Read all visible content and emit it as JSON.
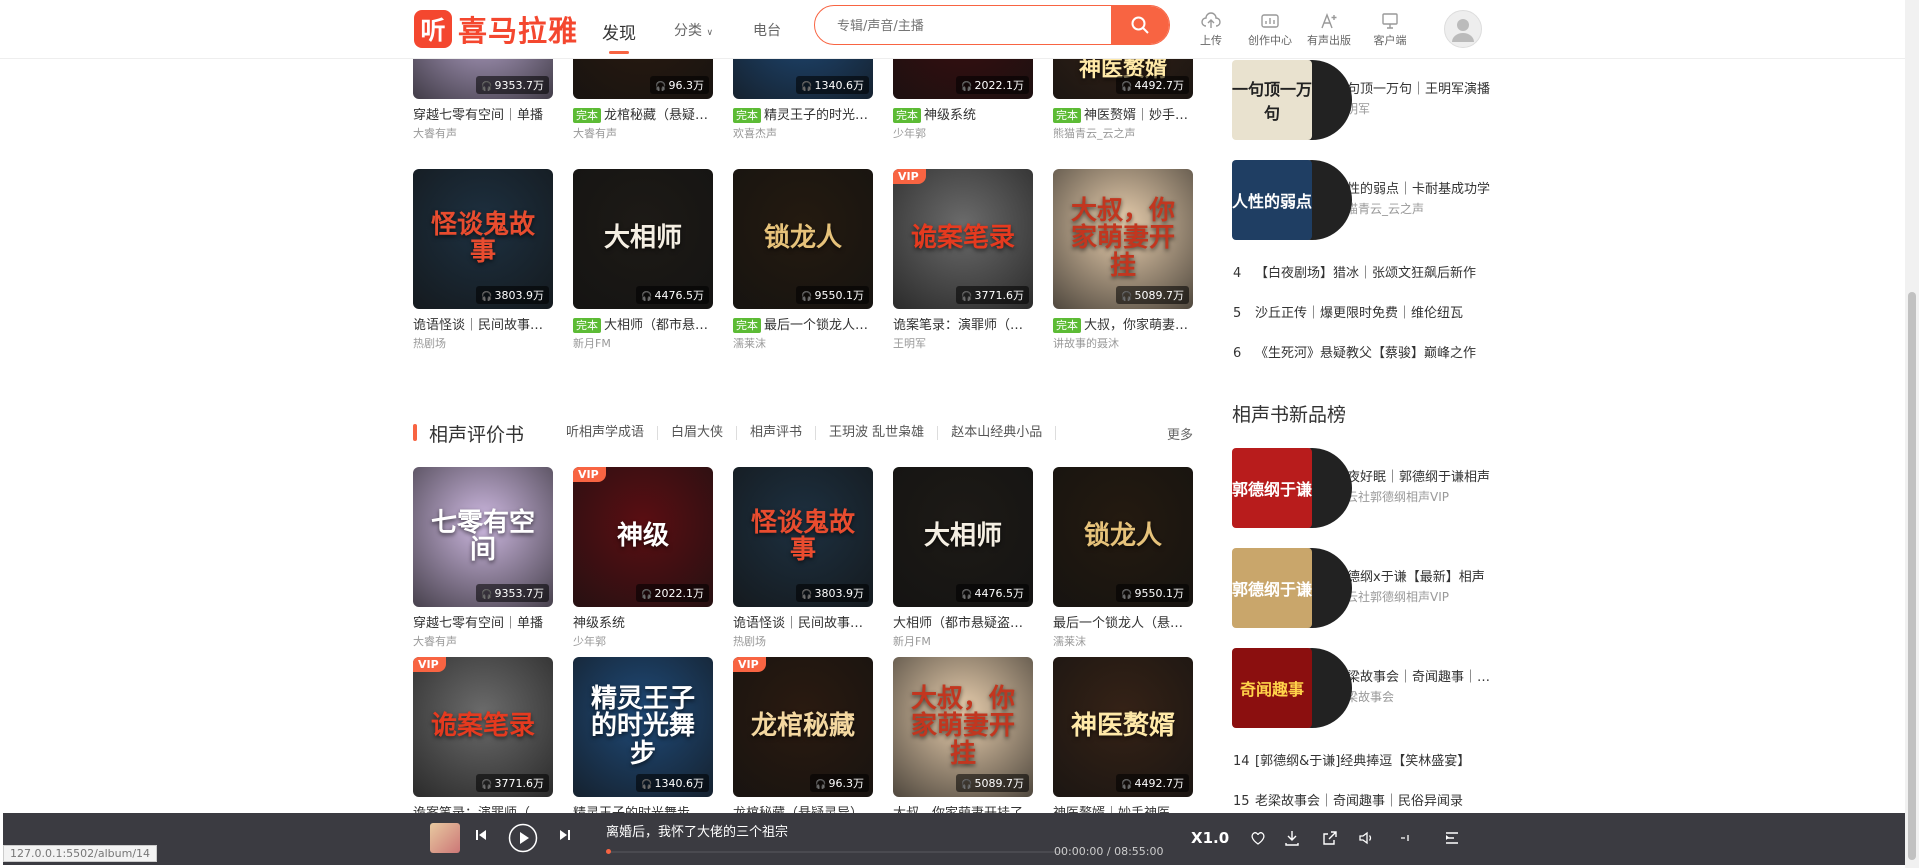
{
  "header": {
    "logo_glyph": "听",
    "logo_text": "喜马拉雅",
    "nav": {
      "discover": "发现",
      "category": "分类",
      "radio": "电台"
    },
    "search_placeholder": "专辑/声音/主播",
    "tools": {
      "upload": "上传",
      "creator": "创作中心",
      "publish": "有声出版",
      "client": "客户端"
    }
  },
  "grid_top": [
    {
      "cover": "",
      "plays": "9353.7万",
      "tag": "",
      "title": "穿越七零有空间｜单播",
      "author": "大睿有声",
      "bg": "#b9a8cf",
      "fg": "#fff"
    },
    {
      "cover": "",
      "plays": "96.3万",
      "tag": "完本",
      "title": "龙棺秘藏（悬疑灵异）",
      "author": "大睿有声",
      "bg": "#2a1a10",
      "fg": "#f3d7a0"
    },
    {
      "cover": "",
      "plays": "1340.6万",
      "tag": "完本",
      "title": "精灵王子的时光舞步",
      "author": "欢喜杰声",
      "bg": "#1f4a78",
      "fg": "#fff"
    },
    {
      "cover": "",
      "plays": "2022.1万",
      "tag": "完本",
      "title": "神级系统",
      "author": "少年郭",
      "bg": "#3a0e10",
      "fg": "#fff"
    },
    {
      "cover": "神医赘婿",
      "plays": "4492.7万",
      "tag": "完本",
      "title": "神医赘婿｜妙手神医",
      "author": "熊猫青云_云之声",
      "bg": "#352216",
      "fg": "#ffe9a8"
    }
  ],
  "grid_row2": [
    {
      "cover": "怪谈鬼故事",
      "plays": "3803.9万",
      "tag": "",
      "vip": "",
      "title": "诡语怪谈｜民间故事合集",
      "author": "热剧场",
      "bg": "#1d3040",
      "fg": "#e84c2f"
    },
    {
      "cover": "大相师",
      "plays": "4476.5万",
      "tag": "完本",
      "vip": "",
      "title": "大相师（都市悬疑盗墓）",
      "author": "新月FM",
      "bg": "#1d1a16",
      "fg": "#f5efe3"
    },
    {
      "cover": "锁龙人",
      "plays": "9550.1万",
      "tag": "完本",
      "vip": "",
      "title": "最后一个锁龙人（悬疑）",
      "author": "濡莱沫",
      "bg": "#241a10",
      "fg": "#e6c27a"
    },
    {
      "cover": "诡案笔录",
      "plays": "3771.6万",
      "tag": "",
      "vip": "VIP",
      "title": "诡案笔录：演罪师（刑侦）",
      "author": "王明军",
      "bg": "#6b6b6b",
      "fg": "#e53a1f"
    },
    {
      "cover": "大叔，你家萌妻开挂",
      "plays": "5089.7万",
      "tag": "完本",
      "vip": "",
      "title": "大叔，你家萌妻开挂了",
      "author": "讲故事的聂沐",
      "bg": "#e9cfae",
      "fg": "#c2361f"
    }
  ],
  "category": {
    "title": "相声评价书",
    "tabs": [
      "听相声学成语",
      "白眉大侠",
      "相声评书",
      "王玥波 乱世枭雄",
      "赵本山经典小品"
    ],
    "more": "更多"
  },
  "grid_row3": [
    {
      "cover": "七零有空间",
      "plays": "9353.7万",
      "vip": "",
      "title": "穿越七零有空间｜单播",
      "author": "大睿有声",
      "bg": "#cdb8e0",
      "fg": "#fff"
    },
    {
      "cover": "神级",
      "plays": "2022.1万",
      "vip": "VIP",
      "title": "神级系统",
      "author": "少年郭",
      "bg": "#5a0e12",
      "fg": "#fff"
    },
    {
      "cover": "怪谈鬼故事",
      "plays": "3803.9万",
      "vip": "",
      "title": "诡语怪谈｜民间故事合集",
      "author": "热剧场",
      "bg": "#1d3040",
      "fg": "#e84c2f"
    },
    {
      "cover": "大相师",
      "plays": "4476.5万",
      "vip": "",
      "title": "大相师（都市悬疑盗墓）",
      "author": "新月FM",
      "bg": "#1d1a16",
      "fg": "#f5efe3"
    },
    {
      "cover": "锁龙人",
      "plays": "9550.1万",
      "vip": "",
      "title": "最后一个锁龙人（悬疑）",
      "author": "濡莱沫",
      "bg": "#241a10",
      "fg": "#e6c27a"
    }
  ],
  "grid_row4": [
    {
      "cover": "诡案笔录",
      "plays": "3771.6万",
      "vip": "VIP",
      "title": "诡案笔录：演罪师（刑侦）",
      "bg": "#6b6b6b",
      "fg": "#e53a1f"
    },
    {
      "cover": "精灵王子的时光舞步",
      "plays": "1340.6万",
      "vip": "",
      "title": "精灵王子的时光舞步",
      "bg": "#1f4a78",
      "fg": "#fff"
    },
    {
      "cover": "龙棺秘藏",
      "plays": "96.3万",
      "vip": "VIP",
      "title": "龙棺秘藏（悬疑灵异）",
      "bg": "#2a1a10",
      "fg": "#f3d7a0"
    },
    {
      "cover": "大叔，你家萌妻开挂",
      "plays": "5089.7万",
      "vip": "",
      "title": "大叔，你家萌妻开挂了",
      "bg": "#e9cfae",
      "fg": "#c2361f"
    },
    {
      "cover": "神医赘婿",
      "plays": "4492.7万",
      "vip": "",
      "title": "神医赘婿｜妙手神医",
      "bg": "#352216",
      "fg": "#ffe9a8"
    }
  ],
  "right": {
    "rank_top": [
      {
        "cover": "一句顶一万句",
        "title": "一句顶一万句｜王明军演播",
        "author": "王明军",
        "bg": "#e9e2cf",
        "fg": "#222"
      },
      {
        "cover": "人性的弱点",
        "title": "人性的弱点｜卡耐基成功学",
        "author": "熊猫青云_云之声",
        "bg": "#1f3e63",
        "fg": "#fff"
      }
    ],
    "rank_lines": [
      {
        "num": "4",
        "text": "【白夜剧场】猎冰｜张颂文狂飙后新作"
      },
      {
        "num": "5",
        "text": "沙丘正传｜爆更限时免费｜维伦纽瓦"
      },
      {
        "num": "6",
        "text": "《生死河》悬疑教父【蔡骏】巅峰之作"
      }
    ],
    "section_title": "相声书新品榜",
    "new_top": [
      {
        "cover": "郭德纲于谦",
        "title": "一夜好眠｜郭德纲于谦相声",
        "author": "德云社郭德纲相声VIP",
        "bg": "#b81c1c",
        "fg": "#fff"
      },
      {
        "cover": "郭德纲于谦",
        "title": "郭德纲x于谦【最新】相声",
        "author": "德云社郭德纲相声VIP",
        "bg": "#c9a66b",
        "fg": "#fff"
      },
      {
        "cover": "奇闻趣事",
        "title": "老梁故事会｜奇闻趣事｜民俗",
        "author": "老梁故事会",
        "bg": "#8b0f0f",
        "fg": "#ffd34a"
      }
    ],
    "new_lines": [
      {
        "num": "14",
        "text": "[郭德纲&于谦]经典捧逗【笑林盛宴】"
      },
      {
        "num": "15",
        "text": "老梁故事会｜奇闻趣事｜民俗异闻录"
      }
    ]
  },
  "player": {
    "title": "离婚后，我怀了大佬的三个祖宗",
    "time": "00:00:00 / 08:55:00",
    "speed": "X1.0",
    "progress": 0
  },
  "status_url": "127.0.0.1:5502/album/14"
}
